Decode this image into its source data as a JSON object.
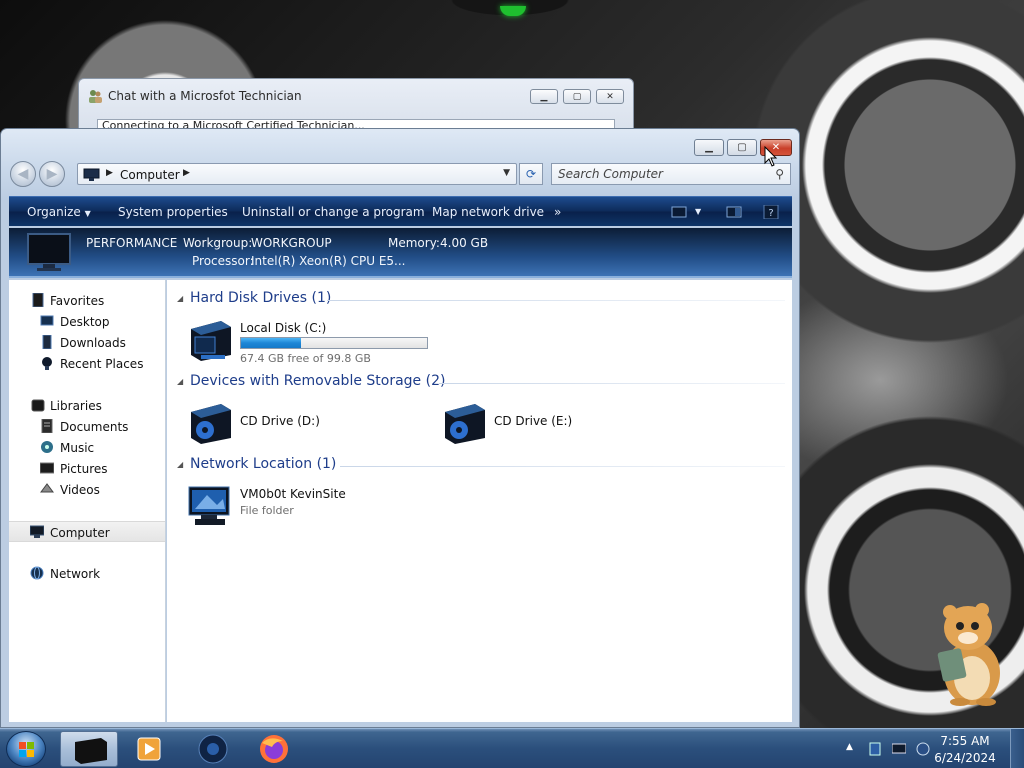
{
  "chat_window": {
    "title": "Chat with a Microsfot Technician",
    "body_text": "Connecting to a Microsoft Certified Technician..."
  },
  "explorer": {
    "address": {
      "crumb": "Computer"
    },
    "search": {
      "placeholder": "Search Computer"
    },
    "toolbar": {
      "organize": "Organize",
      "system_properties": "System properties",
      "uninstall": "Uninstall or change a program",
      "map_drive": "Map network drive",
      "more": "»"
    },
    "info": {
      "computer_name": "PERFORMANCE",
      "workgroup_label": "Workgroup:",
      "workgroup": "WORKGROUP",
      "memory_label": "Memory:",
      "memory": "4.00 GB",
      "processor_label": "Processor:",
      "processor": "Intel(R) Xeon(R) CPU E5..."
    },
    "nav": {
      "favorites": "Favorites",
      "desktop": "Desktop",
      "downloads": "Downloads",
      "recent_places": "Recent Places",
      "libraries": "Libraries",
      "documents": "Documents",
      "music": "Music",
      "pictures": "Pictures",
      "videos": "Videos",
      "computer": "Computer",
      "network": "Network"
    },
    "groups": {
      "hdd": "Hard Disk Drives (1)",
      "removable": "Devices with Removable Storage (2)",
      "network": "Network Location (1)"
    },
    "items": {
      "local_disk": {
        "name": "Local Disk (C:)",
        "free": "67.4 GB free of 99.8 GB",
        "used_fraction": 0.325
      },
      "cd_d": {
        "name": "CD Drive (D:)"
      },
      "cd_e": {
        "name": "CD Drive (E:)"
      },
      "net_folder": {
        "name": "VM0b0t KevinSite",
        "type": "File folder"
      }
    }
  },
  "taskbar": {
    "time": "7:55 AM",
    "date": "6/24/2024"
  },
  "colors": {
    "toolbar_bg": "#0d2a58",
    "group_title": "#1e3d8a",
    "capacity_fill": "#1e86d6",
    "close_button": "#c9402a"
  }
}
